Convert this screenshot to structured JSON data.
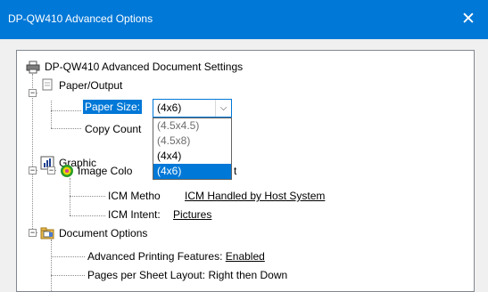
{
  "window": {
    "title": "DP-QW410 Advanced Options",
    "close_symbol": "✕"
  },
  "tree": {
    "root_label": "DP-QW410 Advanced Document Settings",
    "paper_output": {
      "label": "Paper/Output",
      "paper_size_label": "Paper Size:",
      "paper_size_value": "(4x6)",
      "copy_count_label": "Copy Count"
    },
    "graphic": {
      "label": "Graphic",
      "image_color_label": "Image Colo",
      "image_color_tail": "t",
      "icm_method_label": "ICM Metho",
      "icm_method_value": "ICM Handled by Host System",
      "icm_intent_label": "ICM Intent:",
      "icm_intent_value": "Pictures"
    },
    "document_options": {
      "label": "Document Options",
      "adv_printing_label": "Advanced Printing Features:",
      "adv_printing_value": "Enabled",
      "pages_layout_label": "Pages per Sheet Layout:",
      "pages_layout_value": "Right then Down"
    }
  },
  "dropdown": {
    "options": [
      {
        "label": "(4.5x4.5)",
        "state": "disabled"
      },
      {
        "label": "(4.5x8)",
        "state": "disabled"
      },
      {
        "label": "(4x4)",
        "state": "normal"
      },
      {
        "label": "(4x6)",
        "state": "selected"
      }
    ]
  },
  "colors": {
    "accent": "#0078d7",
    "disabled_text": "#6d6d6d"
  },
  "icons": [
    "printer-icon",
    "document-icon",
    "chart-icon",
    "color-wheel-icon",
    "settings-folder-icon"
  ]
}
